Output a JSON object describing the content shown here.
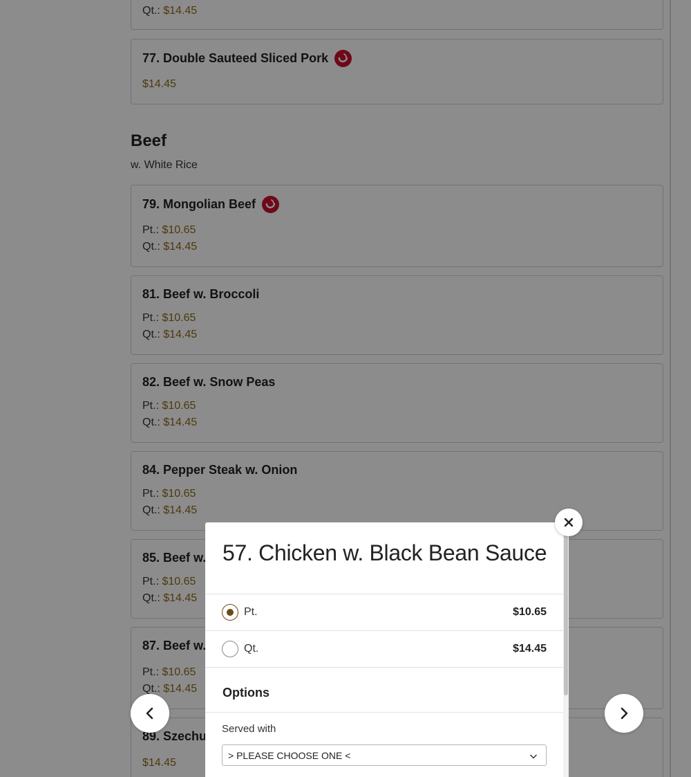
{
  "background_menu": {
    "partial_top_card": {
      "qt_label": "Qt.:",
      "qt_price": "$14.45"
    },
    "card_77": {
      "title": "77. Double Sauteed Sliced Pork",
      "spicy": true,
      "price": "$14.45"
    },
    "section": {
      "title": "Beef",
      "subtitle": "w. White Rice"
    },
    "items": [
      {
        "title": "79. Mongolian Beef",
        "spicy": true,
        "pt_label": "Pt.:",
        "pt_price": "$10.65",
        "qt_label": "Qt.:",
        "qt_price": "$14.45"
      },
      {
        "title": "81. Beef w. Broccoli",
        "spicy": false,
        "pt_label": "Pt.:",
        "pt_price": "$10.65",
        "qt_label": "Qt.:",
        "qt_price": "$14.45"
      },
      {
        "title": "82. Beef w. Snow Peas",
        "spicy": false,
        "pt_label": "Pt.:",
        "pt_price": "$10.65",
        "qt_label": "Qt.:",
        "qt_price": "$14.45"
      },
      {
        "title": "84. Pepper Steak w. Onion",
        "spicy": false,
        "pt_label": "Pt.:",
        "pt_price": "$10.65",
        "qt_label": "Qt.:",
        "qt_price": "$14.45"
      },
      {
        "title": "85. Beef w.",
        "spicy": false,
        "pt_label": "Pt.:",
        "pt_price": "$10.65",
        "qt_label": "Qt.:",
        "qt_price": "$14.45"
      },
      {
        "title": "87. Beef w.",
        "spicy": false,
        "pt_label": "Pt.:",
        "pt_price": "$10.65",
        "qt_label": "Qt.:",
        "qt_price": "$14.45"
      },
      {
        "title": "89. Szechu",
        "spicy": false,
        "price": "$14.45"
      }
    ]
  },
  "modal": {
    "title": "57. Chicken w. Black Bean Sauce",
    "sizes": [
      {
        "label": "Pt.",
        "price": "$10.65",
        "selected": true
      },
      {
        "label": "Qt.",
        "price": "$14.45",
        "selected": false
      }
    ],
    "options_title": "Options",
    "served_with_label": "Served with",
    "served_with_value": "> PLEASE CHOOSE ONE <"
  },
  "icons": {
    "close": "close-icon",
    "prev": "chevron-left-icon",
    "next": "chevron-right-icon",
    "spicy": "chili-pepper-icon",
    "dropdown": "chevron-down-icon"
  },
  "colors": {
    "price_accent": "#8a6a1a",
    "spicy_badge": "#c8102e",
    "radio_selected": "#6b4a16"
  }
}
